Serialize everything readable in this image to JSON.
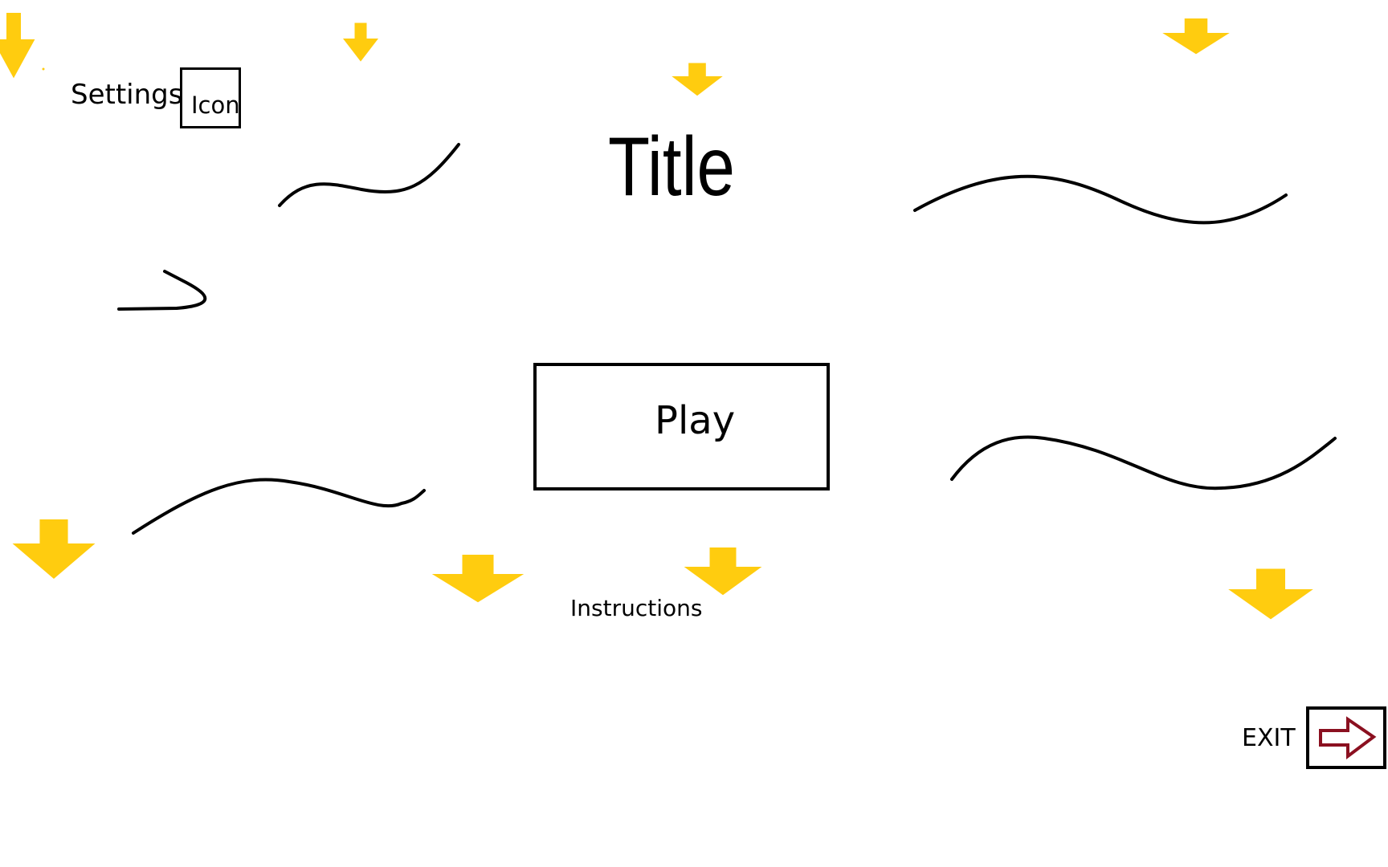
{
  "menu": {
    "settings_label": "Settings",
    "settings_icon_label": "Icon",
    "title": "Title",
    "play_label": "Play",
    "instructions_label": "Instructions",
    "exit_label": "EXIT"
  },
  "colors": {
    "background": "#ffffff",
    "ink": "#000000",
    "arrow_fill": "#ffcc0f",
    "exit_arrow": "#8b1020"
  },
  "icons": {
    "decorative_arrow": "down-arrow-icon",
    "exit_icon": "right-arrow-icon"
  }
}
